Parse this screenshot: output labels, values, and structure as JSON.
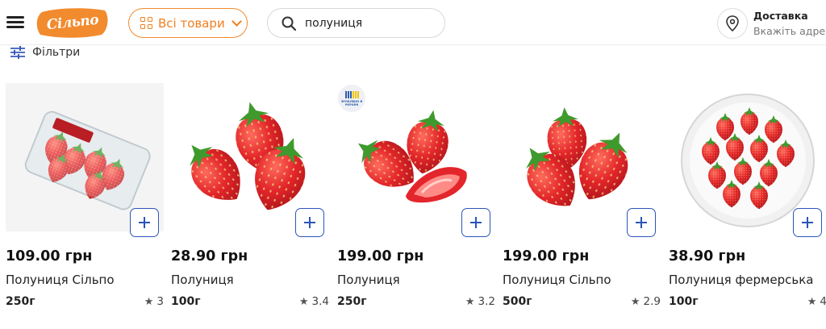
{
  "header": {
    "logo_text": "Сільпо",
    "catalog_label": "Всі товари",
    "search_value": "полуниця",
    "delivery_title": "Доставка",
    "delivery_subtitle": "Вкажіть адресу"
  },
  "filters": {
    "label": "Фільтри"
  },
  "badge": {
    "text": "ЗРОБЛЕНО В УКРАЇНІ"
  },
  "products": [
    {
      "price": "109.00 грн",
      "name": "Полуниця Сільпо",
      "weight": "250г",
      "rating": "3"
    },
    {
      "price": "28.90 грн",
      "name": "Полуниця",
      "weight": "100г",
      "rating": "3.4"
    },
    {
      "price": "199.00 грн",
      "name": "Полуниця",
      "weight": "250г",
      "rating": "3.2"
    },
    {
      "price": "199.00 грн",
      "name": "Полуниця Сільпо",
      "weight": "500г",
      "rating": "2.9"
    },
    {
      "price": "38.90 грн",
      "name": "Полуниця фермерська",
      "weight": "100г",
      "rating": "4"
    }
  ],
  "colors": {
    "brand_orange": "#f07e20",
    "accent_blue": "#2a55b8",
    "strawberry_red": "#e3262b"
  }
}
